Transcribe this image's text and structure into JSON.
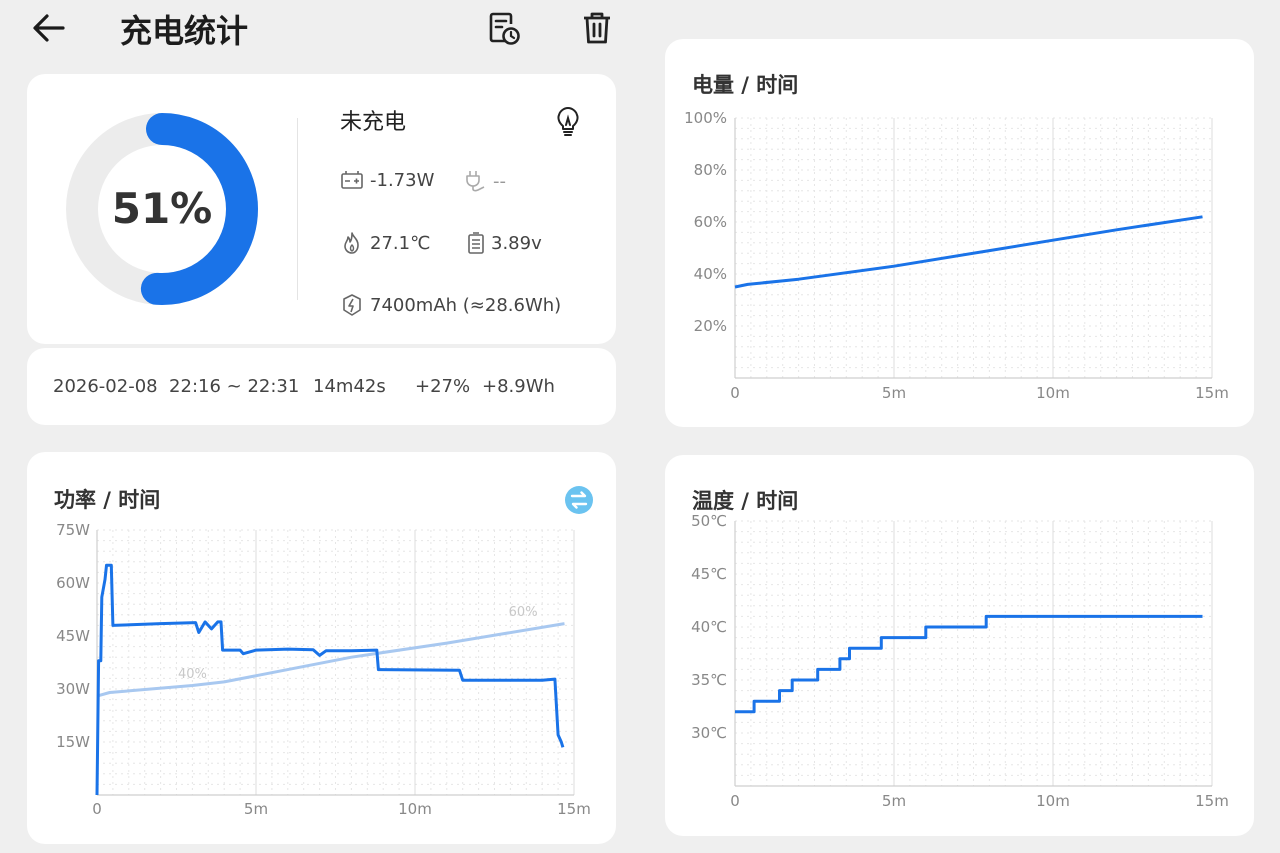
{
  "header": {
    "title": "充电统计",
    "back_icon": "arrow-left-icon",
    "history_icon": "document-clock-icon",
    "delete_icon": "trash-icon"
  },
  "battery": {
    "percent_text": "51%",
    "percent": 51,
    "ring_color": "#1a73e8",
    "status": "未充电",
    "power": "-1.73W",
    "charger": "--",
    "temperature": "27.1℃",
    "voltage": "3.89v",
    "capacity": "7400mAh (≈28.6Wh)"
  },
  "session": {
    "date_range": "2026-02-08  22:16 ~ 22:31",
    "duration": "14m42s",
    "percent_gain": "+27%",
    "energy_gain": "+8.9Wh"
  },
  "charts": {
    "battery": {
      "title": "电量 / 时间",
      "y_ticks": [
        "100%",
        "80%",
        "60%",
        "40%",
        "20%"
      ],
      "x_ticks": [
        "0",
        "5m",
        "10m",
        "15m"
      ]
    },
    "power": {
      "title": "功率 / 时间",
      "swap_icon": "swap-icon",
      "y_ticks": [
        "75W",
        "60W",
        "45W",
        "30W",
        "15W"
      ],
      "x_ticks": [
        "0",
        "5m",
        "10m",
        "15m"
      ],
      "overlay_labels": [
        "40%",
        "60%"
      ]
    },
    "temperature": {
      "title": "温度 / 时间",
      "y_ticks": [
        "50℃",
        "45℃",
        "40℃",
        "35℃",
        "30℃"
      ],
      "x_ticks": [
        "0",
        "5m",
        "10m",
        "15m"
      ]
    }
  },
  "chart_data": [
    {
      "type": "line",
      "title": "电量 / 时间",
      "xlabel": "",
      "ylabel": "",
      "xlim": [
        0,
        15
      ],
      "ylim": [
        0,
        100
      ],
      "x_unit": "min",
      "y_unit": "%",
      "grid": true,
      "series": [
        {
          "color": "#1a73e8",
          "points": [
            [
              0,
              35
            ],
            [
              0.4,
              36
            ],
            [
              2,
              38
            ],
            [
              5,
              43
            ],
            [
              8,
              49
            ],
            [
              10,
              53
            ],
            [
              12,
              57
            ],
            [
              14.7,
              62
            ]
          ]
        }
      ]
    },
    {
      "type": "line",
      "title": "功率 / 时间",
      "xlabel": "",
      "ylabel": "",
      "xlim": [
        0,
        15
      ],
      "ylim": [
        0,
        75
      ],
      "x_unit": "min",
      "y_unit": "W",
      "grid": true,
      "series": [
        {
          "color": "#1a73e8",
          "points": [
            [
              0,
              0
            ],
            [
              0.05,
              38
            ],
            [
              0.12,
              38
            ],
            [
              0.15,
              56
            ],
            [
              0.25,
              61
            ],
            [
              0.3,
              65
            ],
            [
              0.45,
              65
            ],
            [
              0.5,
              48
            ],
            [
              2,
              48.5
            ],
            [
              3.1,
              48.8
            ],
            [
              3.2,
              46
            ],
            [
              3.4,
              49
            ],
            [
              3.6,
              47
            ],
            [
              3.8,
              49
            ],
            [
              3.9,
              49
            ],
            [
              3.95,
              41
            ],
            [
              4.5,
              41
            ],
            [
              4.6,
              40
            ],
            [
              5,
              41
            ],
            [
              6,
              41.3
            ],
            [
              6.8,
              41.1
            ],
            [
              7,
              39.5
            ],
            [
              7.2,
              40.8
            ],
            [
              8,
              40.8
            ],
            [
              8.8,
              41
            ],
            [
              8.85,
              35.5
            ],
            [
              11.4,
              35.3
            ],
            [
              11.5,
              32.5
            ],
            [
              14,
              32.5
            ],
            [
              14.4,
              32.8
            ],
            [
              14.5,
              17
            ],
            [
              14.6,
              15
            ],
            [
              14.65,
              13.5
            ]
          ]
        },
        {
          "color": "#a8c8f0",
          "points": [
            [
              0,
              28
            ],
            [
              0.4,
              29
            ],
            [
              3,
              31
            ],
            [
              4,
              32
            ],
            [
              8,
              39
            ],
            [
              11,
              43
            ],
            [
              14.7,
              48.5
            ]
          ]
        }
      ]
    },
    {
      "type": "line",
      "title": "温度 / 时间",
      "xlabel": "",
      "ylabel": "",
      "xlim": [
        0,
        15
      ],
      "ylim": [
        25,
        50
      ],
      "x_unit": "min",
      "y_unit": "℃",
      "grid": true,
      "series": [
        {
          "color": "#1a73e8",
          "step": true,
          "points": [
            [
              0,
              32
            ],
            [
              0.6,
              32
            ],
            [
              0.6,
              33
            ],
            [
              1.4,
              33
            ],
            [
              1.4,
              34
            ],
            [
              1.8,
              34
            ],
            [
              1.8,
              35
            ],
            [
              2.6,
              35
            ],
            [
              2.6,
              36
            ],
            [
              3.3,
              36
            ],
            [
              3.3,
              37
            ],
            [
              3.6,
              37
            ],
            [
              3.6,
              38
            ],
            [
              4.6,
              38
            ],
            [
              4.6,
              39
            ],
            [
              6,
              39
            ],
            [
              6,
              40
            ],
            [
              7.9,
              40
            ],
            [
              7.9,
              41
            ],
            [
              14.7,
              41
            ]
          ]
        }
      ]
    }
  ]
}
